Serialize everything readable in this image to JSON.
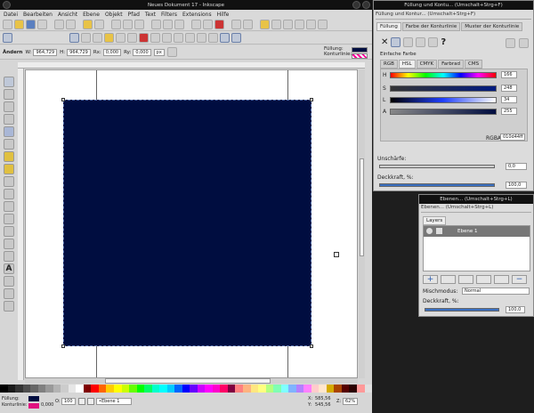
{
  "main": {
    "title": "Neues Dokument 17 - Inkscape",
    "menu": [
      "Datei",
      "Bearbeiten",
      "Ansicht",
      "Ebene",
      "Objekt",
      "Pfad",
      "Text",
      "Filters",
      "Extensions",
      "Hilfe"
    ],
    "tool_controls": {
      "tool": "Ändern",
      "w_label": "W:",
      "w_value": "964,729",
      "h_label": "H:",
      "h_value": "964,729",
      "rx_label": "Rx:",
      "rx_value": "0,000",
      "ry_label": "Ry:",
      "ry_value": "0,000",
      "unit": "px"
    },
    "style_indicator": {
      "fill_label": "Füllung:",
      "stroke_label": "Konturlinie:",
      "fill_color": "#000d40"
    },
    "status": {
      "fill_label": "Füllung:",
      "stroke_label": "Konturlinie:",
      "stroke_width": "0,000",
      "opacity_label": "O:",
      "opacity_value": "100",
      "layer": "•Ebene 1",
      "x_label": "X:",
      "x_value": "585,56",
      "y_label": "Y:",
      "y_value": "545,56",
      "z_label": "Z:",
      "zoom": "62%"
    }
  },
  "fill_stroke": {
    "title": "Füllung und Kontu... (Umschalt+Strg+F)",
    "tab_title": "Füllung und Kontur... (Umschalt+Strg+F)",
    "tabs": [
      "Füllung",
      "Farbe der Konturlinie",
      "Muster der Konturlinie"
    ],
    "section": "Einfache Farbe",
    "color_tabs": [
      "RGB",
      "HSL",
      "CMYK",
      "Farbrad",
      "CMS"
    ],
    "active_color_tab": "HSL",
    "channels": [
      {
        "label": "H",
        "value": "166"
      },
      {
        "label": "S",
        "value": "248"
      },
      {
        "label": "L",
        "value": "34"
      },
      {
        "label": "A",
        "value": "255"
      }
    ],
    "rgba_label": "RGBA:",
    "rgba_value": "010d44ff",
    "blur_label": "Unschärfe:",
    "blur_value": "0,0",
    "opacity_label": "Deckkraft, %:",
    "opacity_value": "100,0"
  },
  "layers": {
    "title": "Ebenen... (Umschalt+Strg+L)",
    "tab_title": "Ebenen... (Umschalt+Strg+L)",
    "tab": "Layers",
    "layer_name": "Ebene 1",
    "blend_label": "Mischmodus:",
    "blend_value": "Normal",
    "opacity_label": "Deckkraft, %:",
    "opacity_value": "100,0"
  },
  "colors": {
    "accent": "#4a78c0",
    "document_rect": "#000d40",
    "palette": [
      "#000000",
      "#1a1a1a",
      "#333333",
      "#4d4d4d",
      "#666666",
      "#808080",
      "#999999",
      "#b3b3b3",
      "#cccccc",
      "#e6e6e6",
      "#ffffff",
      "#800000",
      "#ff0000",
      "#ff6600",
      "#ffcc00",
      "#ffff00",
      "#ccff00",
      "#66ff00",
      "#00ff00",
      "#00ff66",
      "#00ffcc",
      "#00ffff",
      "#00ccff",
      "#0066ff",
      "#0000ff",
      "#6600ff",
      "#cc00ff",
      "#ff00ff",
      "#ff00cc",
      "#ff0066",
      "#800040",
      "#ff8080",
      "#ffb380",
      "#ffe680",
      "#ffff80",
      "#b3ff80",
      "#80ffb3",
      "#80ffff",
      "#80b3ff",
      "#b380ff",
      "#ff80ff",
      "#ffcccc",
      "#ffe6cc",
      "#d4aa00",
      "#aa4400",
      "#550000",
      "#2b0000",
      "#ff9999",
      "#e0e0e0"
    ]
  }
}
